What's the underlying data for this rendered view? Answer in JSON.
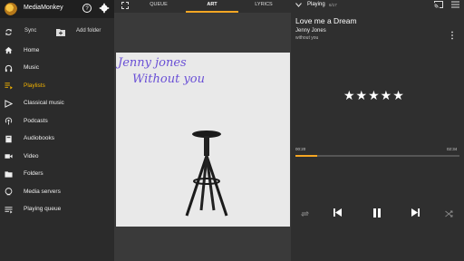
{
  "app": {
    "title": "MediaMonkey"
  },
  "actions": {
    "sync_label": "Sync",
    "add_folder_label": "Add folder"
  },
  "menu": [
    {
      "label": "Home",
      "icon": "home-icon"
    },
    {
      "label": "Music",
      "icon": "headphones-icon"
    },
    {
      "label": "Playlists",
      "icon": "playlist-icon"
    },
    {
      "label": "Classical music",
      "icon": "conductor-icon"
    },
    {
      "label": "Podcasts",
      "icon": "podcast-icon"
    },
    {
      "label": "Audiobooks",
      "icon": "book-icon"
    },
    {
      "label": "Video",
      "icon": "video-icon"
    },
    {
      "label": "Folders",
      "icon": "folder-icon"
    },
    {
      "label": "Media servers",
      "icon": "server-icon"
    },
    {
      "label": "Playing queue",
      "icon": "queue-icon"
    }
  ],
  "active_menu": "Playlists",
  "tabs": [
    {
      "label": "QUEUE"
    },
    {
      "label": "ART"
    },
    {
      "label": "LYRICS"
    }
  ],
  "active_tab": "ART",
  "art": {
    "line1": "Jenny jones",
    "line2": "Without you"
  },
  "now_playing": {
    "label": "Playing",
    "count": "6/17",
    "title": "Love me a Dream",
    "artist": "Jenny Jones",
    "album": "without you",
    "rating_stars": "★★★★★",
    "rating": 5,
    "elapsed": "00:20",
    "duration": "02:34",
    "progress": 0.13
  },
  "colors": {
    "accent": "#f5a623",
    "active_menu": "#f5b400"
  }
}
